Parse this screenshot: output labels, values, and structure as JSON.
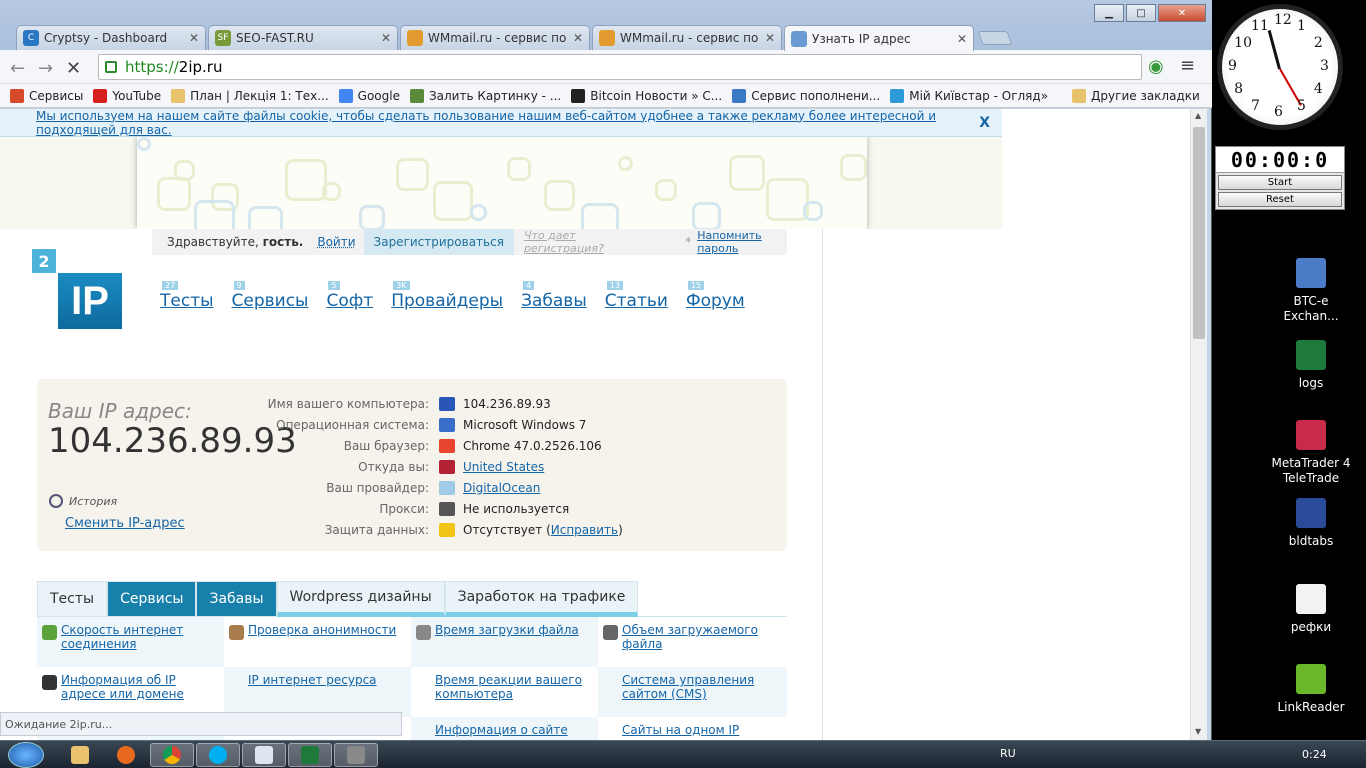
{
  "tabs": [
    {
      "label": "Cryptsy - Dashboard",
      "fav": "C",
      "color": "#2a77c4"
    },
    {
      "label": "SEO-FAST.RU",
      "fav": "SF",
      "color": "#7a9a3a"
    },
    {
      "label": "WMmail.ru - сервис почто",
      "fav": "",
      "color": "#e39a2f"
    },
    {
      "label": "WMmail.ru - сервис почто",
      "fav": "",
      "color": "#e39a2f"
    },
    {
      "label": "Узнать IP адрес",
      "fav": "",
      "color": "#6a9bd0"
    }
  ],
  "window": {
    "min": "▁",
    "max": "□",
    "close": "✕"
  },
  "url": {
    "scheme": "https://",
    "host": "2ip.ru"
  },
  "bookmarks": [
    {
      "label": "Сервисы",
      "color": "#d64b2a"
    },
    {
      "label": "YouTube",
      "color": "#d62020"
    },
    {
      "label": "План | Лекція 1: Тех...",
      "color": "#e8c36b"
    },
    {
      "label": "Google",
      "color": "#4285f4"
    },
    {
      "label": "Залить Картинку - ...",
      "color": "#5a8a3a"
    },
    {
      "label": "Bitcoin Новости » С...",
      "color": "#222"
    },
    {
      "label": "Сервис пополнени...",
      "color": "#3a7ac4"
    },
    {
      "label": "Мій Київстар - Огляд",
      "color": "#2b9ad6"
    }
  ],
  "bookmarks_more": "»",
  "bookmarks_other": "Другие закладки",
  "cookie": {
    "text": "Мы используем на нашем сайте файлы cookie, чтобы сделать пользование нашим веб-сайтом удобнее а также рекламу более интересной и подходящей для вас.",
    "close": "X"
  },
  "login": {
    "greet": "Здравствуйте,",
    "guest": "гость.",
    "login": "Войти",
    "register": "Зарегистрироваться",
    "what": "Что дает регистрация?",
    "star": "*",
    "remind": "Напомнить пароль"
  },
  "logo": {
    "n": "2",
    "ip": "IP"
  },
  "menu": [
    {
      "badge": "27",
      "label": "Тесты"
    },
    {
      "badge": "9",
      "label": "Сервисы"
    },
    {
      "badge": "5",
      "label": "Софт"
    },
    {
      "badge": "3K",
      "label": "Провайдеры"
    },
    {
      "badge": "4",
      "label": "Забавы"
    },
    {
      "badge": "13",
      "label": "Статьи"
    },
    {
      "badge": "15",
      "label": "Форум"
    }
  ],
  "info": {
    "ip_label": "Ваш IP адрес:",
    "ip": "104.236.89.93",
    "history": "История",
    "change": "Сменить IP-адрес",
    "rows": [
      {
        "k": "Имя вашего компьютера:",
        "v": "104.236.89.93",
        "link": false,
        "color": "#2a56b8"
      },
      {
        "k": "Операционная система:",
        "v": "Microsoft Windows 7",
        "link": false,
        "color": "#3a6fc9"
      },
      {
        "k": "Ваш браузер:",
        "v": "Chrome 47.0.2526.106",
        "link": false,
        "color": "#e8442e"
      },
      {
        "k": "Откуда вы:",
        "v": "United States",
        "link": true,
        "color": "#b22234"
      },
      {
        "k": "Ваш провайдер:",
        "v": "DigitalOcean",
        "link": true,
        "color": "#9fcbe6"
      },
      {
        "k": "Прокси:",
        "v": "Не используется",
        "link": false,
        "color": "#555"
      },
      {
        "k": "Защита данных:",
        "v": "Отсутствует (",
        "fix": "Исправить",
        "tail": ")",
        "link": false,
        "color": "#f2c417"
      }
    ]
  },
  "section_tabs": [
    "Тесты",
    "Сервисы",
    "Забавы",
    "Wordpress дизайны",
    "Заработок на трафике"
  ],
  "grid": [
    {
      "label": "Скорость интернет соединения",
      "icon": "#5aa33a"
    },
    {
      "label": "Проверка анонимности",
      "icon": "#a97c4c"
    },
    {
      "label": "Время загрузки файла",
      "icon": "#888"
    },
    {
      "label": "Объем загружаемого файла",
      "icon": "#666"
    },
    {
      "label": "Информация об IP адресе или домене",
      "icon": "#333"
    },
    {
      "label": "IP интернет ресурса",
      "icon": ""
    },
    {
      "label": "Время реакции вашего компьютера",
      "icon": ""
    },
    {
      "label": "Система управления сайтом (CMS)",
      "icon": ""
    },
    {
      "label": "",
      "icon": ""
    },
    {
      "label": "",
      "icon": ""
    },
    {
      "label": "Информация о сайте",
      "icon": ""
    },
    {
      "label": "Сайты на одном IP",
      "icon": ""
    }
  ],
  "status": "Ожидание 2ip.ru...",
  "clock": {
    "nums": [
      "12",
      "1",
      "2",
      "3",
      "4",
      "5",
      "6",
      "7",
      "8",
      "9",
      "10",
      "11"
    ]
  },
  "stopwatch": {
    "time": "00:00:0",
    "start": "Start",
    "reset": "Reset"
  },
  "desktop_icons": [
    {
      "label": "BTC-e Exchan...",
      "color": "#4a7cc8"
    },
    {
      "label": "logs",
      "color": "#1e7a3a"
    },
    {
      "label": "MetaTrader 4 TeleTrade",
      "color": "#c82a4a"
    },
    {
      "label": "bldtabs",
      "color": "#2a4a9a"
    },
    {
      "label": "рефки",
      "color": "#f2f2f2"
    },
    {
      "label": "LinkReader",
      "color": "#6ab82a"
    }
  ],
  "tray": {
    "lang": "RU",
    "time": "0:24"
  }
}
